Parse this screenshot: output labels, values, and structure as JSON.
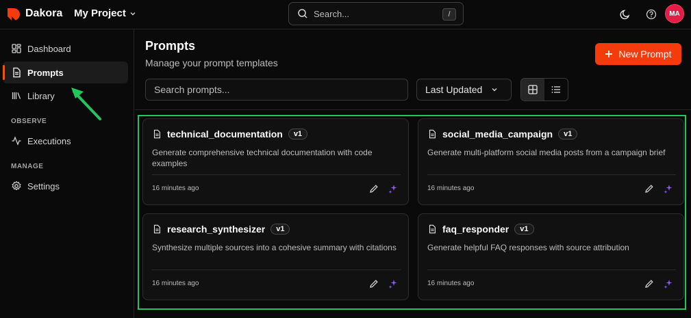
{
  "app": {
    "brand": "Dakora",
    "project": "My Project"
  },
  "topbar": {
    "search_placeholder": "Search...",
    "search_shortcut": "/",
    "user_initials": "MA"
  },
  "sidebar": {
    "items": [
      {
        "label": "Dashboard",
        "icon": "dashboard-icon"
      },
      {
        "label": "Prompts",
        "icon": "document-icon",
        "active": true
      },
      {
        "label": "Library",
        "icon": "library-icon"
      }
    ],
    "observe_heading": "OBSERVE",
    "observe_items": [
      {
        "label": "Executions",
        "icon": "activity-icon"
      }
    ],
    "manage_heading": "MANAGE",
    "manage_items": [
      {
        "label": "Settings",
        "icon": "gear-icon"
      }
    ]
  },
  "main": {
    "title": "Prompts",
    "subtitle": "Manage your prompt templates",
    "new_button": "New Prompt",
    "search_placeholder": "Search prompts...",
    "sort_label": "Last Updated",
    "view_mode": "grid",
    "cards": [
      {
        "name": "technical_documentation",
        "version": "v1",
        "description": "Generate comprehensive technical documentation with code examples",
        "updated": "16 minutes ago"
      },
      {
        "name": "social_media_campaign",
        "version": "v1",
        "description": "Generate multi-platform social media posts from a campaign brief",
        "updated": "16 minutes ago"
      },
      {
        "name": "research_synthesizer",
        "version": "v1",
        "description": "Synthesize multiple sources into a cohesive summary with citations",
        "updated": "16 minutes ago"
      },
      {
        "name": "faq_responder",
        "version": "v1",
        "description": "Generate helpful FAQ responses with source attribution",
        "updated": "16 minutes ago"
      }
    ]
  },
  "colors": {
    "accent": "#f43b0c",
    "highlight": "#22c55e",
    "ai": "#8b5cf6"
  }
}
